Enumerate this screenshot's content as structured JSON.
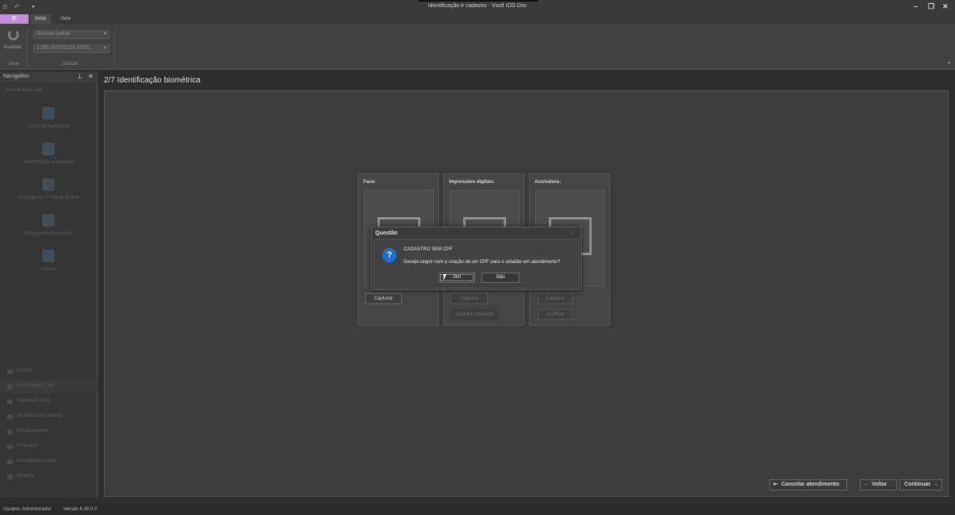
{
  "window": {
    "title": "Identificação e cadastro - Vsoft IOS Doc",
    "qa_icons": [
      "app-icon",
      "undo-icon",
      "customize-icon"
    ],
    "controls": [
      "minimize-icon",
      "restore-icon",
      "close-icon"
    ]
  },
  "tabs": {
    "menu_label": "IE",
    "items": [
      "Início",
      "View"
    ]
  },
  "ribbon": {
    "update_label": "Atualizar",
    "view_group": "View",
    "default_group": "Default",
    "domain_select": "Domínio padrão",
    "post_select": "1-255: POSTO DE ATEN..."
  },
  "navigation": {
    "title": "Navigation",
    "section": "Atendimento Civil",
    "items": [
      {
        "label": "Consulta Identidade",
        "icon": "search-id-icon"
      },
      {
        "label": "Identificação e cadastro",
        "icon": "id-card-icon"
      },
      {
        "label": "Emissão de 2ª Via de Boleto",
        "icon": "receipt-icon"
      },
      {
        "label": "Entrega de documento",
        "icon": "delivery-icon"
      },
      {
        "label": "Acervo",
        "icon": "archive-icon"
      }
    ],
    "groups": [
      "Padrão",
      "Atendimento Civil",
      "Impressão Civil",
      "Identificação Criminal",
      "Desaparecidos",
      "Funcional",
      "Necropapiloscopia",
      "Sistema"
    ]
  },
  "main": {
    "page_title": "2/7 Identificação biométrica",
    "cards": {
      "face": {
        "title": "Face:",
        "capture": "Capturar"
      },
      "fingerprints": {
        "title": "Impressões digitais:",
        "capture": "Capturar",
        "capture_rolled": "Capturar pousado"
      },
      "signature": {
        "title": "Assinatura:",
        "capture": "Capturar",
        "justify": "Justificar"
      }
    },
    "actions": {
      "cancel": "Cancelar atendimento",
      "back": "Voltar",
      "continue": "Continuar"
    }
  },
  "dialog": {
    "title": "Questão",
    "heading": "CADASTRO SEM CPF",
    "message": "Deseja seguir com a criação de um CPF para o cidadão em atendimento?",
    "yes": "Sim",
    "no": "Não",
    "icon": "question-icon"
  },
  "status": {
    "user": "Usuário: Administrador",
    "version": "Versão 6.38.0.0"
  },
  "colors": {
    "menu_tab": "#c58fd8",
    "dialog_icon": "#1f6fd0"
  }
}
